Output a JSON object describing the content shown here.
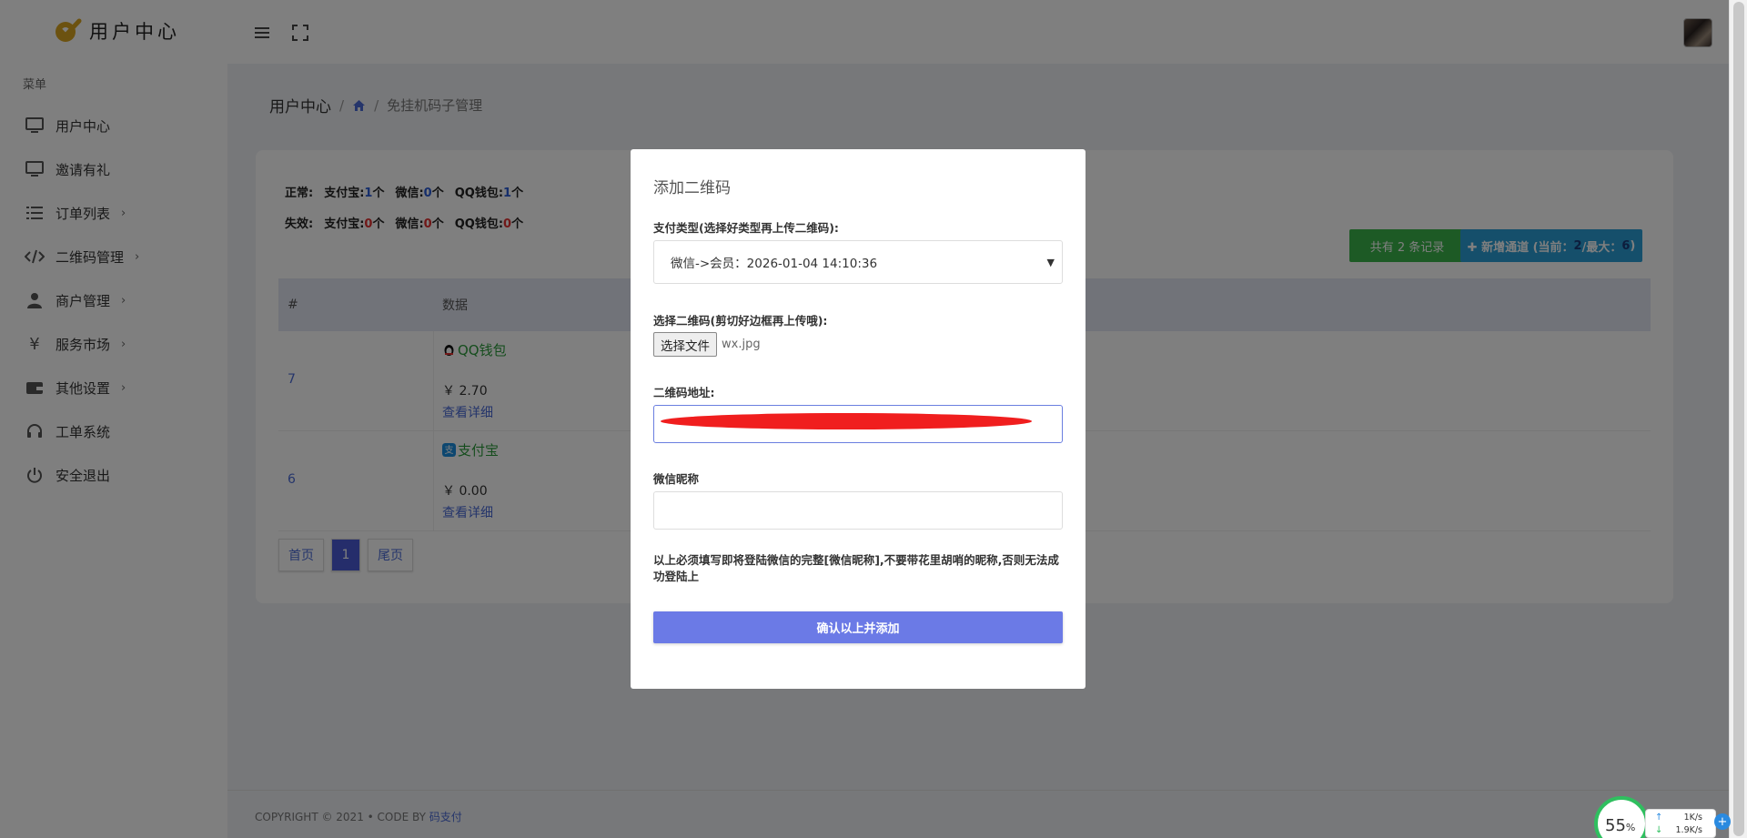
{
  "header": {
    "logo_text": "用户中心"
  },
  "sidebar": {
    "menu_title": "菜单",
    "items": [
      {
        "label": "用户中心",
        "icon": "monitor-icon",
        "has_caret": false
      },
      {
        "label": "邀请有礼",
        "icon": "monitor-icon",
        "has_caret": false
      },
      {
        "label": "订单列表",
        "icon": "list-icon",
        "has_caret": true
      },
      {
        "label": "二维码管理",
        "icon": "code-icon",
        "has_caret": true
      },
      {
        "label": "商户管理",
        "icon": "user-icon",
        "has_caret": true
      },
      {
        "label": "服务市场",
        "icon": "yen-icon",
        "has_caret": true
      },
      {
        "label": "其他设置",
        "icon": "wallet-icon",
        "has_caret": true
      },
      {
        "label": "工单系统",
        "icon": "headset-icon",
        "has_caret": false
      },
      {
        "label": "安全退出",
        "icon": "power-icon",
        "has_caret": false
      }
    ]
  },
  "breadcrumb": {
    "root": "用户中心",
    "sep": "/",
    "current": "免挂机码子管理"
  },
  "stats": {
    "normal_label": "正常:",
    "fail_label": "失效:",
    "alipay": "支付宝:",
    "wechat": "微信:",
    "qq": "QQ钱包:",
    "unit": "个",
    "normal": {
      "alipay": "1",
      "wechat": "0",
      "qq": "1"
    },
    "fail": {
      "alipay": "0",
      "wechat": "0",
      "qq": "0"
    }
  },
  "buttons": {
    "records": "共有 2 条记录",
    "new_prefix": "✚ 新增通道 (当前：",
    "new_current": "2",
    "new_mid": "/最大：",
    "new_max": "6",
    "new_suffix": ")"
  },
  "table": {
    "headers": [
      "#",
      "数据"
    ],
    "rows": [
      {
        "id": "7",
        "pay_type": "QQ钱包",
        "amount": "￥ 2.70",
        "detail": "查看详细"
      },
      {
        "id": "6",
        "pay_type": "支付宝",
        "amount": "￥ 0.00",
        "detail": "查看详细"
      }
    ]
  },
  "pager": {
    "first": "首页",
    "page": "1",
    "last": "尾页"
  },
  "footer": {
    "copyright": "COPYRIGHT © 2021  •  CODE BY ",
    "brand": "码支付"
  },
  "modal": {
    "title": "添加二维码",
    "pay_type_label": "支付类型(选择好类型再上传二维码):",
    "pay_type_value": "微信->会员：2026-01-04 14:10:36",
    "qr_label": "选择二维码(剪切好边框再上传哦):",
    "file_button": "选择文件",
    "file_name": "wx.jpg",
    "qr_url_label": "二维码地址:",
    "nickname_label": "微信昵称",
    "nickname_value": "",
    "note": "以上必须填写即将登陆微信的完整[微信昵称],不要带花里胡哨的昵称,否则无法成功登陆上",
    "submit": "确认以上并添加"
  },
  "net_widget": {
    "percent": "55",
    "percent_sign": "%",
    "up": "1K/s",
    "down": "1.9K/s"
  },
  "colors": {
    "accent": "#6b7ae6",
    "green": "#3ab44a",
    "blue": "#2a9fd6",
    "red": "#e23030"
  }
}
